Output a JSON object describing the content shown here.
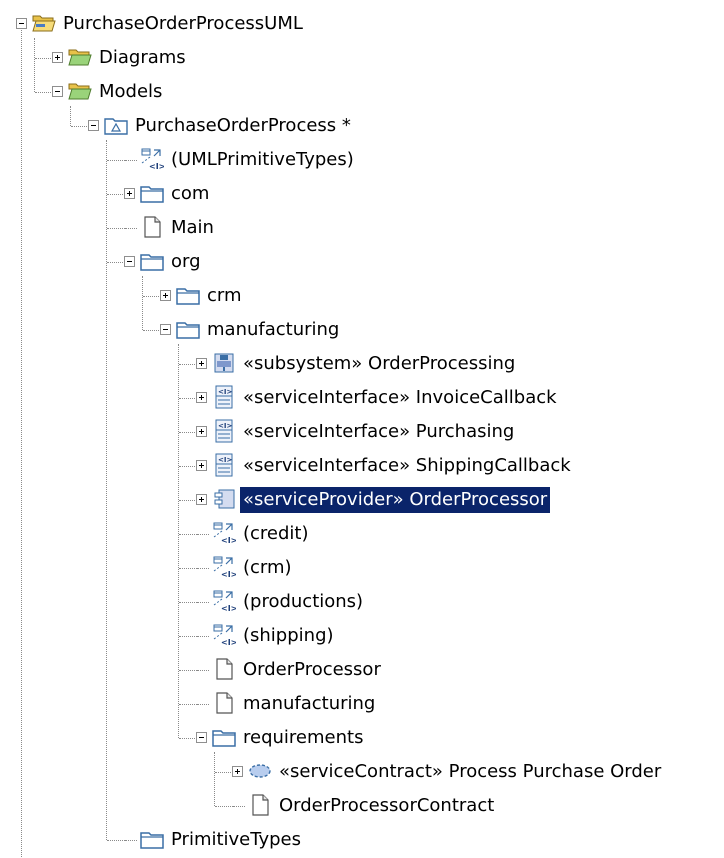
{
  "tree": [
    {
      "label": "PurchaseOrderProcessUML",
      "icon": "open-project-folder-icon",
      "level": 0,
      "toggle": "minus"
    },
    {
      "label": "Diagrams",
      "icon": "open-folder-icon",
      "level": 1,
      "toggle": "plus"
    },
    {
      "label": "Models",
      "icon": "open-folder-icon",
      "level": 1,
      "toggle": "minus"
    },
    {
      "label": "PurchaseOrderProcess *",
      "icon": "uml-model-icon",
      "level": 2,
      "toggle": "minus"
    },
    {
      "label": "(UMLPrimitiveTypes)",
      "icon": "element-import-icon",
      "level": 3,
      "toggle": "none"
    },
    {
      "label": "com",
      "icon": "package-icon",
      "level": 3,
      "toggle": "plus"
    },
    {
      "label": "Main",
      "icon": "diagram-icon",
      "level": 3,
      "toggle": "none"
    },
    {
      "label": "org",
      "icon": "package-icon",
      "level": 3,
      "toggle": "minus"
    },
    {
      "label": "crm",
      "icon": "package-icon",
      "level": 4,
      "toggle": "plus"
    },
    {
      "label": "manufacturing",
      "icon": "package-icon",
      "level": 4,
      "toggle": "minus"
    },
    {
      "label": "«subsystem» OrderProcessing",
      "icon": "subsystem-icon",
      "level": 5,
      "toggle": "plus"
    },
    {
      "label": "«serviceInterface» InvoiceCallback",
      "icon": "interface-icon",
      "level": 5,
      "toggle": "plus"
    },
    {
      "label": "«serviceInterface» Purchasing",
      "icon": "interface-icon",
      "level": 5,
      "toggle": "plus"
    },
    {
      "label": "«serviceInterface» ShippingCallback",
      "icon": "interface-icon",
      "level": 5,
      "toggle": "plus"
    },
    {
      "label": "«serviceProvider» OrderProcessor",
      "icon": "component-icon",
      "level": 5,
      "toggle": "plus",
      "selected": true
    },
    {
      "label": "(credit)",
      "icon": "element-import-icon",
      "level": 5,
      "toggle": "none"
    },
    {
      "label": "(crm)",
      "icon": "element-import-icon",
      "level": 5,
      "toggle": "none"
    },
    {
      "label": "(productions)",
      "icon": "element-import-icon",
      "level": 5,
      "toggle": "none"
    },
    {
      "label": "(shipping)",
      "icon": "element-import-icon",
      "level": 5,
      "toggle": "none"
    },
    {
      "label": "OrderProcessor",
      "icon": "diagram-icon",
      "level": 5,
      "toggle": "none"
    },
    {
      "label": "manufacturing",
      "icon": "diagram-icon",
      "level": 5,
      "toggle": "none"
    },
    {
      "label": "requirements",
      "icon": "package-icon",
      "level": 5,
      "toggle": "minus"
    },
    {
      "label": "«serviceContract» Process Purchase Order",
      "icon": "collaboration-icon",
      "level": 6,
      "toggle": "plus"
    },
    {
      "label": "OrderProcessorContract",
      "icon": "diagram-icon",
      "level": 6,
      "toggle": "none"
    },
    {
      "label": "PrimitiveTypes",
      "icon": "package-icon",
      "level": 3,
      "toggle": "none"
    }
  ],
  "colors": {
    "selection": "#0a246a",
    "folder_yellow": "#f3d36b",
    "folder_green": "#9ad37a",
    "package_blue": "#3a6ea5",
    "dotted_line": "#8a8a8a"
  }
}
